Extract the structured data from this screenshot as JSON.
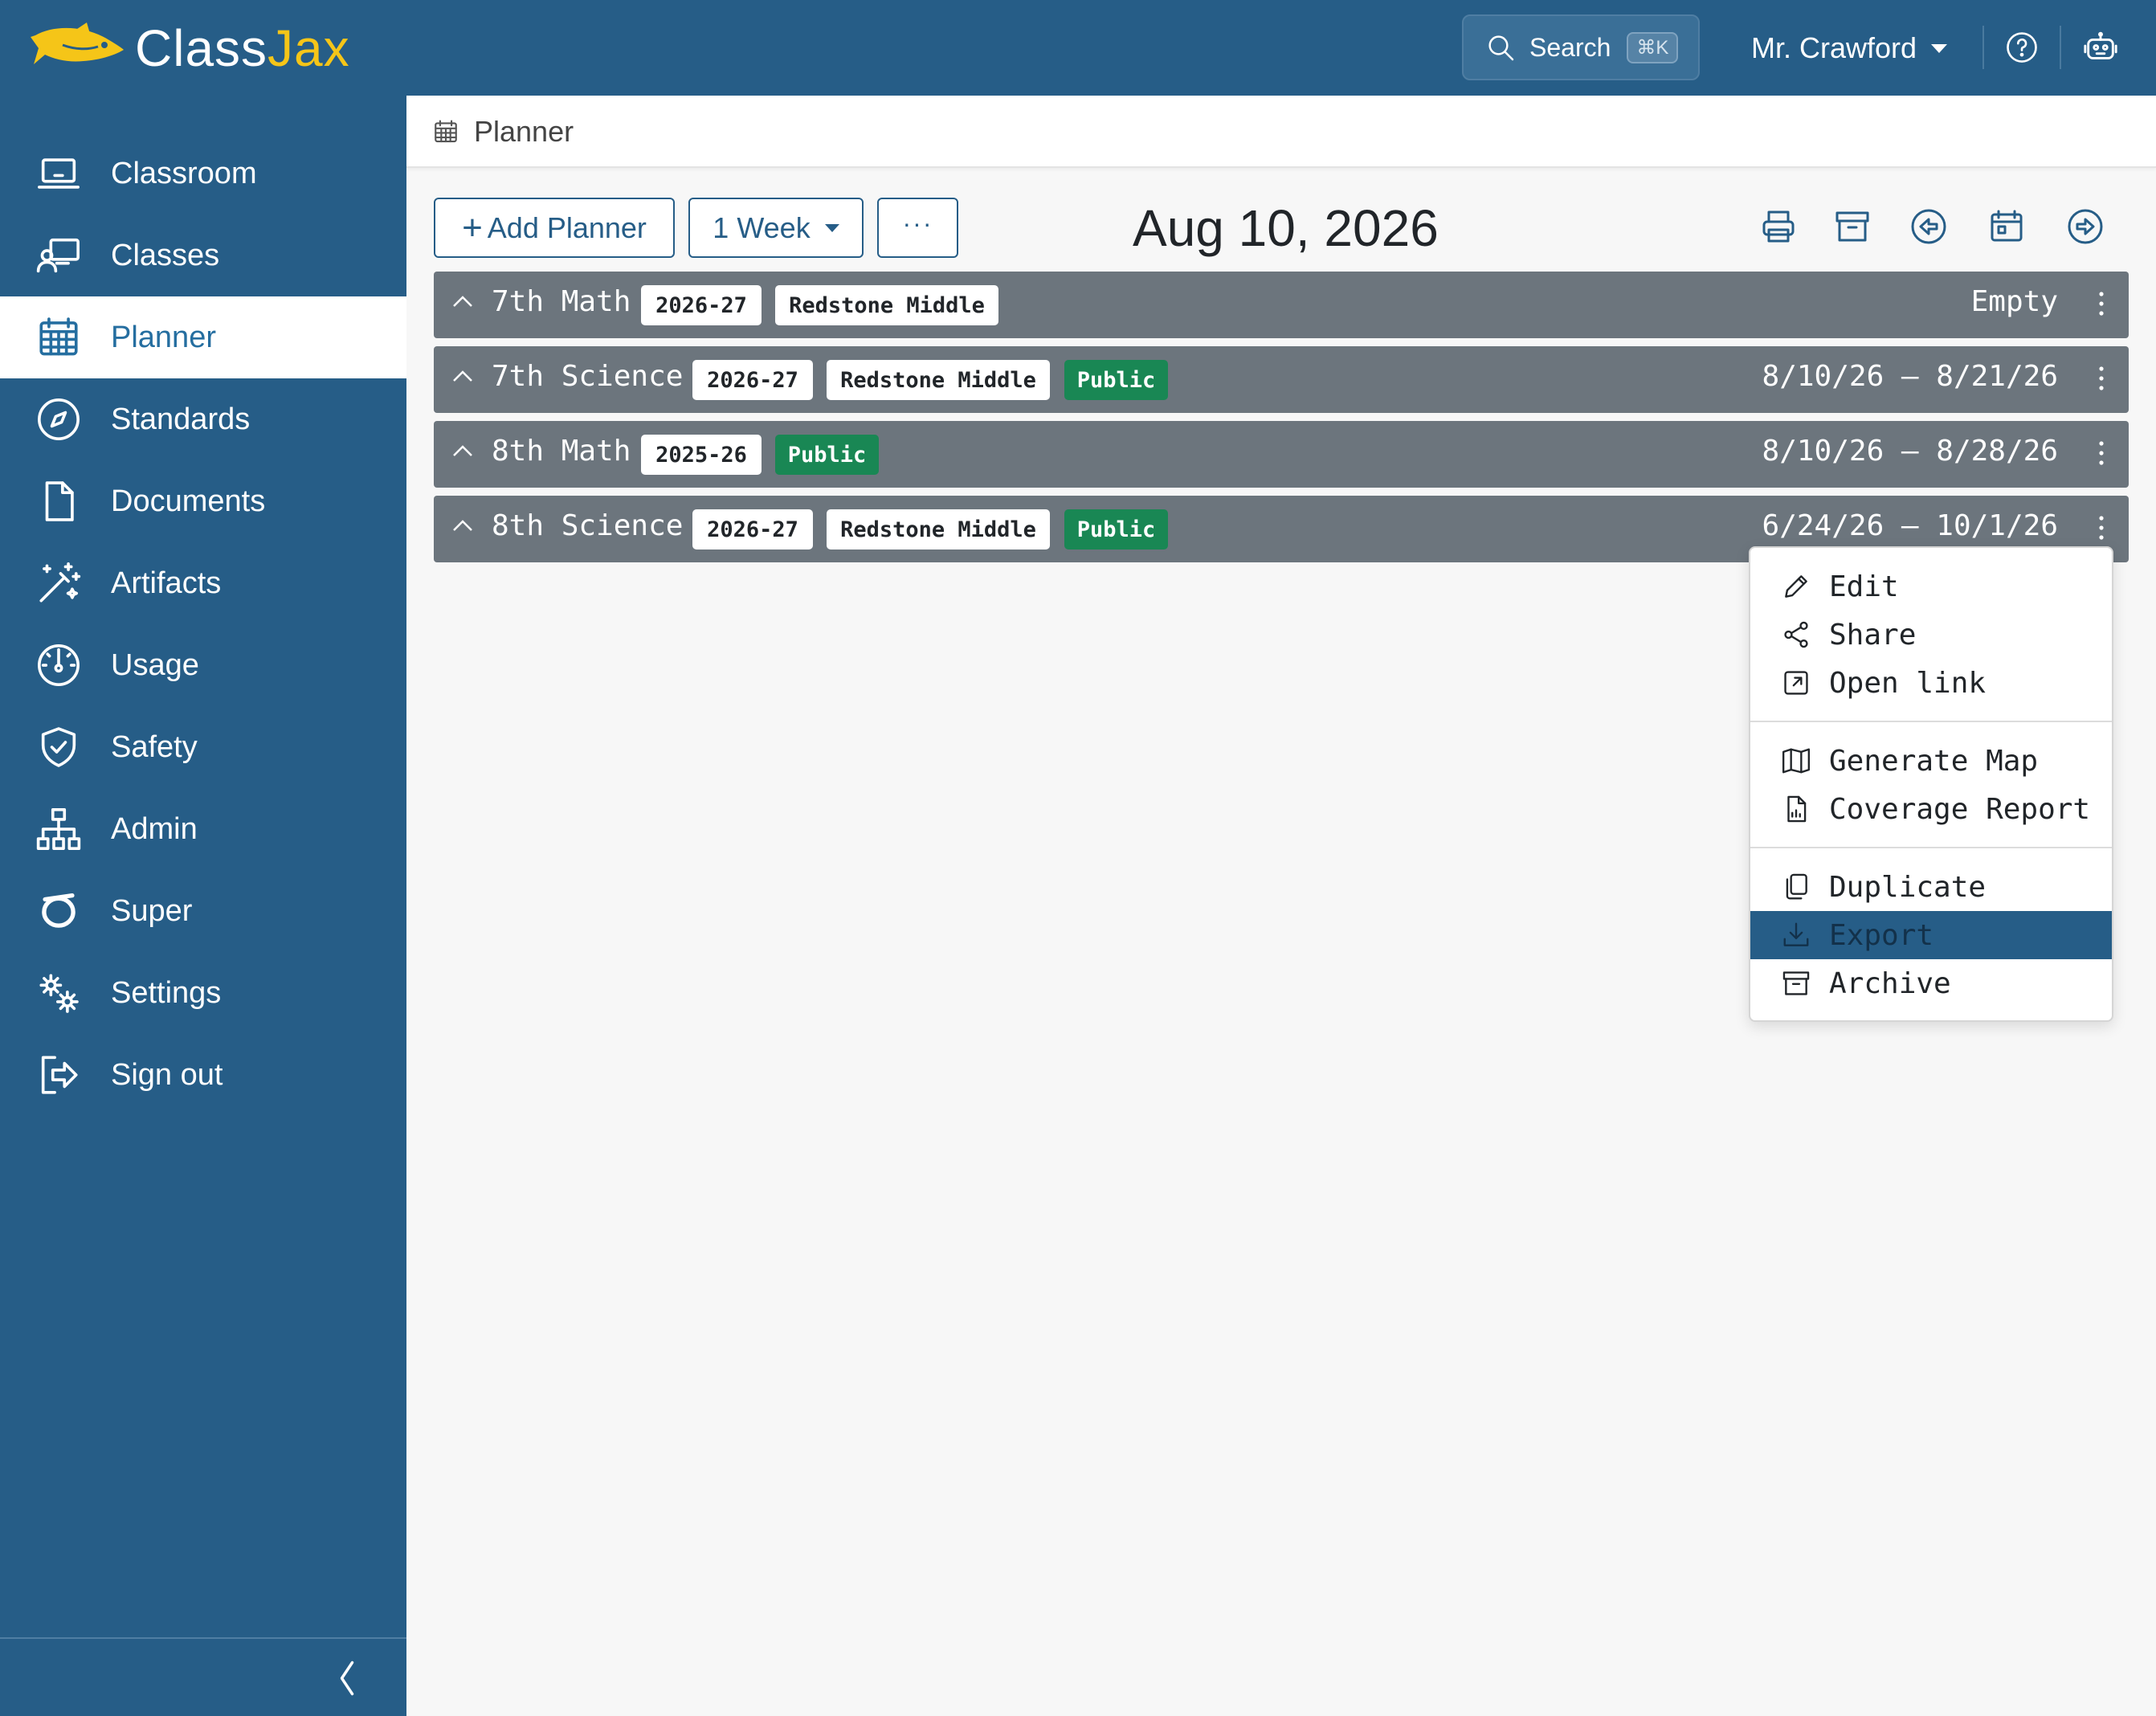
{
  "app": {
    "logo_class": "Class",
    "logo_jax": "Jax",
    "search_label": "Search",
    "search_shortcut": "⌘K",
    "user_name": "Mr. Crawford"
  },
  "sidebar": {
    "items": [
      {
        "label": "Classroom",
        "icon": "laptop-icon"
      },
      {
        "label": "Classes",
        "icon": "presentation-icon"
      },
      {
        "label": "Planner",
        "icon": "calendar-icon",
        "active": true
      },
      {
        "label": "Standards",
        "icon": "compass-icon"
      },
      {
        "label": "Documents",
        "icon": "document-icon"
      },
      {
        "label": "Artifacts",
        "icon": "magic-wand-icon"
      },
      {
        "label": "Usage",
        "icon": "gauge-icon"
      },
      {
        "label": "Safety",
        "icon": "shield-check-icon"
      },
      {
        "label": "Admin",
        "icon": "org-chart-icon"
      },
      {
        "label": "Super",
        "icon": "ring-icon"
      },
      {
        "label": "Settings",
        "icon": "gears-icon"
      },
      {
        "label": "Sign out",
        "icon": "sign-out-icon"
      }
    ]
  },
  "breadcrumb": {
    "title": "Planner"
  },
  "toolbar": {
    "add_planner_label": "Add Planner",
    "week_label": "1 Week",
    "more_label": "···",
    "date": "Aug 10, 2026"
  },
  "planners": [
    {
      "name": "7th Math",
      "year": "2026-27",
      "school": "Redstone Middle",
      "public": "",
      "range": "Empty"
    },
    {
      "name": "7th Science",
      "year": "2026-27",
      "school": "Redstone Middle",
      "public": "Public",
      "range": "8/10/26 – 8/21/26"
    },
    {
      "name": "8th Math",
      "year": "2025-26",
      "school": "",
      "public": "Public",
      "range": "8/10/26 – 8/28/26"
    },
    {
      "name": "8th Science",
      "year": "2026-27",
      "school": "Redstone Middle",
      "public": "Public",
      "range": "6/24/26 – 10/1/26"
    }
  ],
  "menu": {
    "edit": "Edit",
    "share": "Share",
    "open_link": "Open link",
    "generate_map": "Generate Map",
    "coverage_report": "Coverage Report",
    "duplicate": "Duplicate",
    "export": "Export",
    "archive": "Archive",
    "highlighted": "Export"
  },
  "colors": {
    "brand": "#265d87",
    "logo_accent": "#f5c518",
    "row_bg": "#6c757d",
    "public_badge": "#198754"
  }
}
